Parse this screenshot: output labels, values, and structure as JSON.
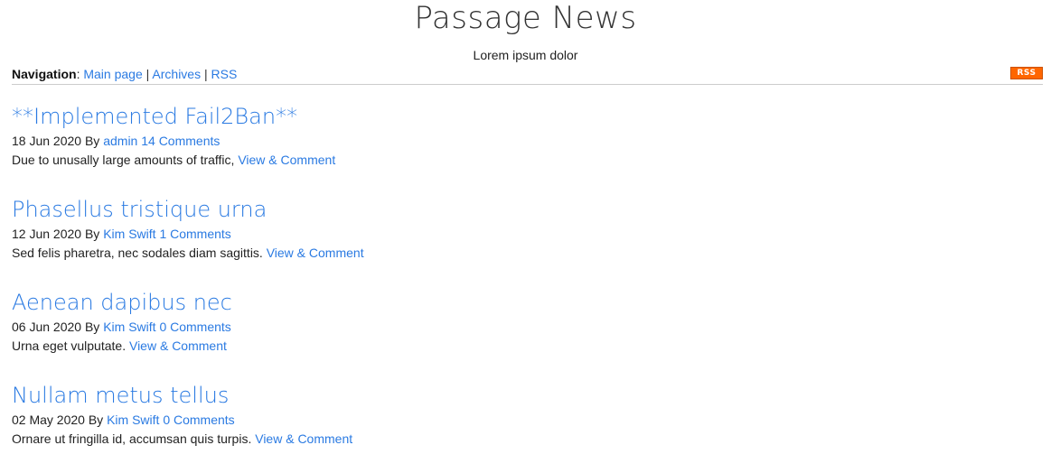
{
  "site": {
    "title": "Passage News",
    "subtitle": "Lorem ipsum dolor"
  },
  "nav": {
    "label": "Navigation",
    "colon": ":",
    "separator": "|",
    "links": [
      "Main page",
      "Archives",
      "RSS"
    ],
    "rss_badge": "RSS",
    "rss_badge_color": "#ff6600"
  },
  "colors": {
    "link": "#2a7ae2",
    "text": "#222222"
  },
  "posts": [
    {
      "title": "**Implemented Fail2Ban**",
      "date": "18 Jun 2020",
      "by": "By",
      "author": "admin",
      "comments": "14 Comments",
      "excerpt": "Due to unusally large amounts of traffic,",
      "link": "View & Comment"
    },
    {
      "title": "Phasellus tristique urna",
      "date": "12 Jun 2020",
      "by": "By",
      "author": "Kim Swift",
      "comments": "1 Comments",
      "excerpt": "Sed felis pharetra, nec sodales diam sagittis.",
      "link": "View & Comment"
    },
    {
      "title": "Aenean dapibus nec",
      "date": "06 Jun 2020",
      "by": "By",
      "author": "Kim Swift",
      "comments": "0 Comments",
      "excerpt": "Urna eget vulputate.",
      "link": "View & Comment"
    },
    {
      "title": "Nullam metus tellus",
      "date": "02 May 2020",
      "by": "By",
      "author": "Kim Swift",
      "comments": "0 Comments",
      "excerpt": "Ornare ut fringilla id, accumsan quis turpis.",
      "link": "View & Comment"
    }
  ]
}
